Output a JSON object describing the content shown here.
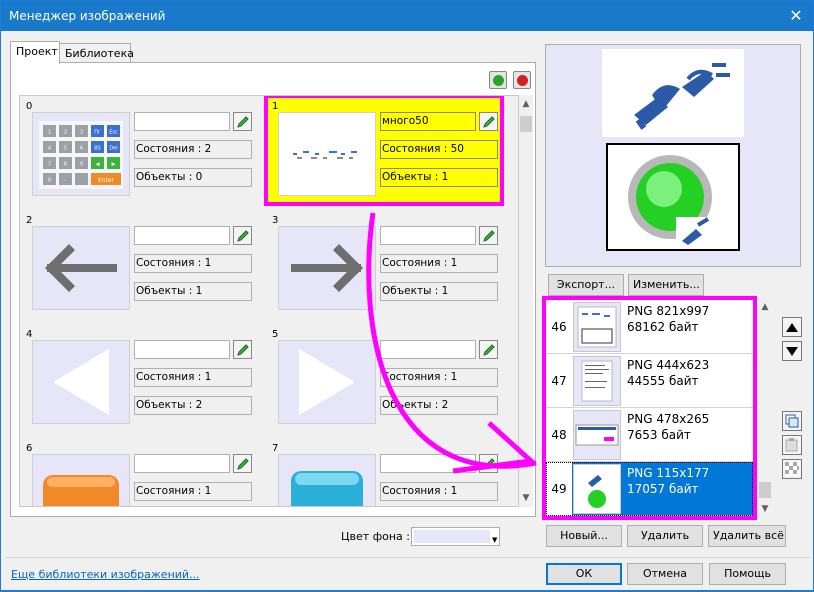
{
  "window": {
    "title": "Менеджер изображений",
    "close_glyph": "✕"
  },
  "tabs": [
    {
      "label": "Проект",
      "active": true
    },
    {
      "label": "Библиотека",
      "active": false
    }
  ],
  "toolbar_icons": [
    "add-image-icon",
    "delete-image-icon"
  ],
  "cells": [
    {
      "num": "0",
      "name": "",
      "states": "Состояния : 2",
      "objects": "Объекты : 0",
      "thumb": "keypad"
    },
    {
      "num": "1",
      "name": "много50",
      "states": "Состояния : 50",
      "objects": "Объекты : 1",
      "thumb": "dots",
      "selected": true
    },
    {
      "num": "2",
      "name": "",
      "states": "Состояния : 1",
      "objects": "Объекты : 1",
      "thumb": "arrow-left"
    },
    {
      "num": "3",
      "name": "",
      "states": "Состояния : 1",
      "objects": "Объекты : 1",
      "thumb": "arrow-right"
    },
    {
      "num": "4",
      "name": "",
      "states": "Состояния : 1",
      "objects": "Объекты : 2",
      "thumb": "triangle-left"
    },
    {
      "num": "5",
      "name": "",
      "states": "Состояния : 1",
      "objects": "Объекты : 2",
      "thumb": "triangle-right"
    },
    {
      "num": "6",
      "name": "",
      "states": "Состояния : 1",
      "objects": "",
      "thumb": "orange-button"
    },
    {
      "num": "7",
      "name": "",
      "states": "Состояния : 1",
      "objects": "",
      "thumb": "blue-button"
    }
  ],
  "keypad_keys": [
    "1",
    "2",
    "3",
    "Пг",
    "Esc",
    "4",
    "5",
    "6",
    "BS",
    "Del",
    "7",
    "8",
    "9",
    "◀",
    "▶",
    "0",
    "-",
    ".",
    "Enter"
  ],
  "preview_buttons": {
    "export": "Экспорт...",
    "edit": "Изменить..."
  },
  "list_items": [
    {
      "idx": "46",
      "format": "PNG 821x997",
      "size": "68162 байт"
    },
    {
      "idx": "47",
      "format": "PNG 444x623",
      "size": "44555 байт"
    },
    {
      "idx": "48",
      "format": "PNG 478x265",
      "size": "7653 байт"
    },
    {
      "idx": "49",
      "format": "PNG 115x177",
      "size": "17057 байт",
      "selected": true
    }
  ],
  "list_buttons": {
    "new": "Новый...",
    "delete": "Удалить",
    "delete_all": "Удалить всё"
  },
  "bg_color": {
    "label": "Цвет фона :",
    "value": "#e6e6f8"
  },
  "footer": {
    "link": "Еще библиотеки изображений...",
    "ok": "ОК",
    "cancel": "Отмена",
    "help": "Помощь"
  },
  "colors": {
    "accent": "#0078d7",
    "highlight_border": "#ff00ff",
    "highlight_fill": "#ffff00",
    "titlebar": "#1979ca"
  }
}
